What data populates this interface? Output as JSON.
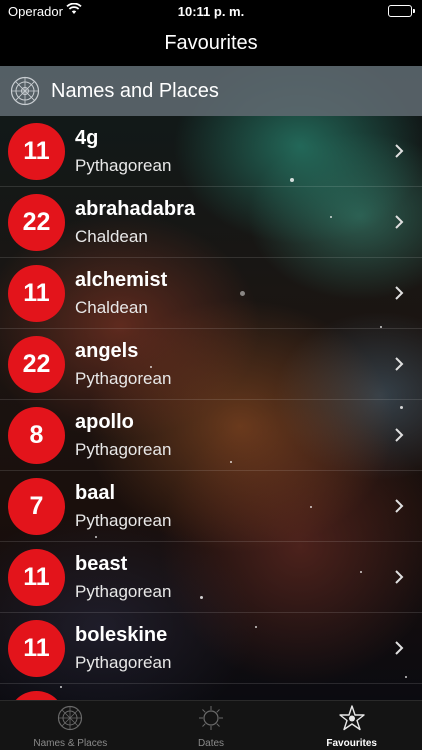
{
  "status_bar": {
    "carrier": "Operador",
    "time": "10:11 p. m."
  },
  "nav": {
    "title": "Favourites"
  },
  "section": {
    "title": "Names and Places"
  },
  "colors": {
    "badge": "#e3141b",
    "header_bg": "#5f6970"
  },
  "rows": [
    {
      "number": "11",
      "name": "4g",
      "system": "Pythagorean"
    },
    {
      "number": "22",
      "name": "abrahadabra",
      "system": "Chaldean"
    },
    {
      "number": "11",
      "name": "alchemist",
      "system": "Chaldean"
    },
    {
      "number": "22",
      "name": "angels",
      "system": "Pythagorean"
    },
    {
      "number": "8",
      "name": "apollo",
      "system": "Pythagorean"
    },
    {
      "number": "7",
      "name": "baal",
      "system": "Pythagorean"
    },
    {
      "number": "11",
      "name": "beast",
      "system": "Pythagorean"
    },
    {
      "number": "11",
      "name": "boleskine",
      "system": "Pythagorean"
    }
  ],
  "tabs": [
    {
      "label": "Names & Places",
      "icon": "mandala-icon"
    },
    {
      "label": "Dates",
      "icon": "sun-icon"
    },
    {
      "label": "Favourites",
      "icon": "star-icon"
    }
  ]
}
